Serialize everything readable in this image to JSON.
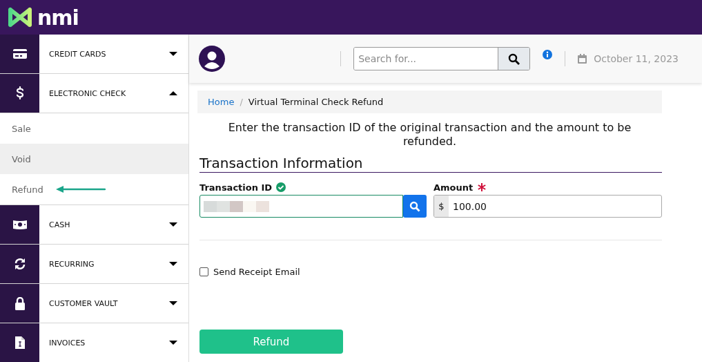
{
  "brand": {
    "name": "nmi"
  },
  "sidebar": {
    "groups": [
      {
        "label": "CREDIT CARDS",
        "expanded": false
      },
      {
        "label": "ELECTRONIC CHECK",
        "expanded": true,
        "children": [
          {
            "label": "Sale",
            "selected": false,
            "pointer": false
          },
          {
            "label": "Void",
            "selected": true,
            "pointer": false
          },
          {
            "label": "Refund",
            "selected": false,
            "pointer": true
          }
        ]
      },
      {
        "label": "CASH",
        "expanded": false
      },
      {
        "label": "RECURRING",
        "expanded": false
      },
      {
        "label": "CUSTOMER VAULT",
        "expanded": false
      },
      {
        "label": "INVOICES",
        "expanded": false
      }
    ]
  },
  "topbar": {
    "search": {
      "placeholder": "Search for..."
    },
    "date": "October 11, 2023"
  },
  "breadcrumb": [
    {
      "label": "Home",
      "kind": "link"
    },
    {
      "label": "/",
      "kind": "separator"
    },
    {
      "label": "Virtual Terminal Check Refund",
      "kind": "current"
    }
  ],
  "instructions": "Enter the transaction ID of the original transaction and the amount to be refunded.",
  "section_title": "Transaction Information",
  "fields": [
    {
      "label": "Transaction ID",
      "kind": "lookup",
      "valid": true,
      "required": false,
      "value_redacted": true
    },
    {
      "label": "Amount",
      "kind": "currency",
      "valid": false,
      "required": true,
      "prefix": "$",
      "value": "100.00"
    }
  ],
  "send_receipt": {
    "label": "Send Receipt Email",
    "checked": false
  },
  "submit": {
    "label": "Refund"
  }
}
